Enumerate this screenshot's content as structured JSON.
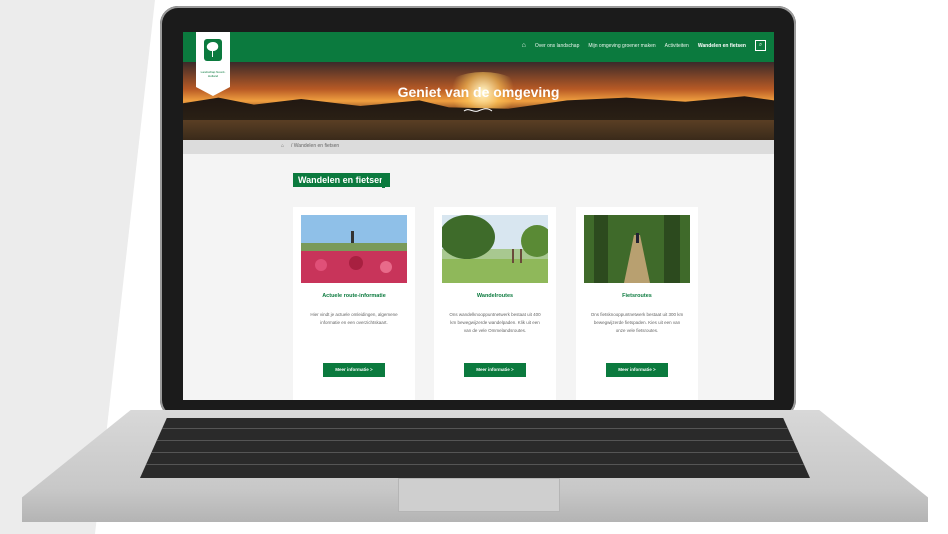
{
  "nav": {
    "items": [
      "Over ons landschap",
      "Mijn omgeving groener maken",
      "Activiteiten",
      "Wandelen en fietsen"
    ],
    "home_icon": "home-icon",
    "search_icon": "search-icon"
  },
  "logo": {
    "text": "Landschap Noord-Holland"
  },
  "hero": {
    "title": "Geniet van de omgeving"
  },
  "breadcrumb": {
    "text": "/ Wandelen en fietsen"
  },
  "section": {
    "title": "Wandelen en fietsen"
  },
  "cards": [
    {
      "title": "Actuele route-informatie",
      "text": "Hier vindt je actuele omleidingen, algemene informatie en een overzichtskaart.",
      "button": "Meer informatie >"
    },
    {
      "title": "Wandelroutes",
      "text": "Ons wandelknooppuntnetwerk bestaat uit 400 km bewegwijzerde wandelpaden. Klik uit een van de vele Ommelandsroutes.",
      "button": "Meer informatie >"
    },
    {
      "title": "Fietsroutes",
      "text": "Ons fietsknooppuntnetwerk bestaat uit 300 km bewegwijzerde fietspaden. Kies uit een van onze vele fietsroutes.",
      "button": "Meer informatie >"
    }
  ],
  "colors": {
    "brand_green": "#0b7a3e",
    "background": "#f4f4f4"
  }
}
